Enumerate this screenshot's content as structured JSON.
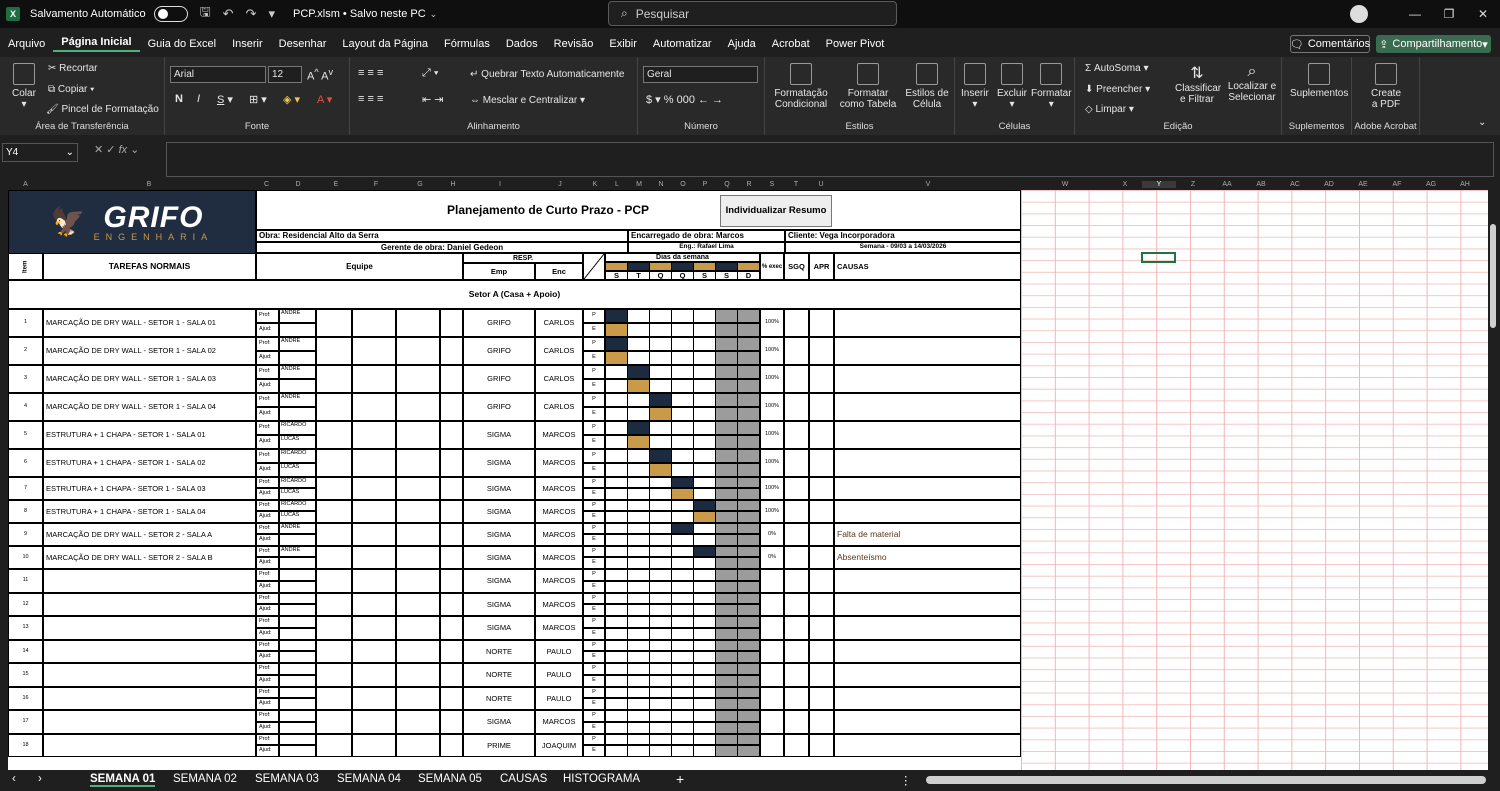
{
  "titlebar": {
    "autosave_label": "Salvamento Automático",
    "file": "PCP.xlsm • Salvo neste PC",
    "search_placeholder": "Pesquisar"
  },
  "menu": [
    "Arquivo",
    "Página Inicial",
    "Guia do Excel",
    "Inserir",
    "Desenhar",
    "Layout da Página",
    "Fórmulas",
    "Dados",
    "Revisão",
    "Exibir",
    "Automatizar",
    "Ajuda",
    "Acrobat",
    "Power Pivot"
  ],
  "menu_active": "Página Inicial",
  "comments_label": "Comentários",
  "share_label": "Compartilhamento",
  "ribbon": {
    "clipboard": {
      "paste": "Colar",
      "cut": "Recortar",
      "copy": "Copiar",
      "painter": "Pincel de Formatação",
      "label": "Área de Transferência"
    },
    "font": {
      "name": "Arial",
      "size": "12",
      "label": "Fonte"
    },
    "align": {
      "wrap": "Quebrar Texto Automaticamente",
      "merge": "Mesclar e Centralizar",
      "label": "Alinhamento"
    },
    "number": {
      "format": "Geral",
      "label": "Número"
    },
    "styles": {
      "cond": "Formatação Condicional",
      "table": "Formatar como Tabela",
      "cell": "Estilos de Célula",
      "label": "Estilos"
    },
    "cells": {
      "insert": "Inserir",
      "delete": "Excluir",
      "format": "Formatar",
      "label": "Células"
    },
    "editing": {
      "autosum": "AutoSoma",
      "fill": "Preencher",
      "clear": "Limpar",
      "sort": "Classificar e Filtrar",
      "find": "Localizar e Selecionar",
      "label": "Edição"
    },
    "addins": {
      "btn": "Suplementos",
      "label": "Suplementos"
    },
    "acrobat": {
      "btn": "Create a PDF",
      "label": "Adobe Acrobat"
    }
  },
  "namebox": "Y4",
  "columns": [
    "A",
    "B",
    "C",
    "D",
    "E",
    "F",
    "G",
    "H",
    "I",
    "J",
    "K",
    "L",
    "M",
    "N",
    "O",
    "P",
    "Q",
    "R",
    "S",
    "T",
    "U",
    "V",
    "W",
    "X",
    "Y",
    "Z",
    "AA",
    "AB",
    "AC",
    "AD",
    "AE",
    "AF",
    "AG",
    "AH"
  ],
  "sheet": {
    "logo_text": "GRIFO",
    "logo_sub": "ENGENHARIA",
    "title": "Planejamento de Curto Prazo - PCP",
    "summary_button": "Individualizar Resumo",
    "obra": "Obra: Residencial Alto da Serra",
    "encarregado": "Encarregado de obra: Marcos",
    "cliente": "Cliente: Vega Incorporadora",
    "gerente": "Gerente de obra: Daniel Gedeon",
    "eng": "Eng.: Rafael Lima",
    "semana": "Semana - 09/03 a 14/03/2026",
    "h_item": "Item",
    "h_tarefas": "TAREFAS NORMAIS",
    "h_equipe": "Equipe",
    "h_resp": "RESP.",
    "h_emp": "Emp",
    "h_enc": "Enc",
    "h_dias": "Dias da semana",
    "days": [
      "S",
      "T",
      "Q",
      "Q",
      "S",
      "S",
      "D"
    ],
    "h_exec": "% exec",
    "h_sgq": "SGQ",
    "h_apr": "APR",
    "h_causas": "CAUSAS",
    "sector": "Setor A (Casa + Apoio)",
    "lbl_p": "P",
    "lbl_e": "E",
    "lbl_prof": "Prof:",
    "lbl_ajud": "Ajud:",
    "rows": [
      {
        "n": "1",
        "task": "MARCAÇÃO DE DRY WALL - SETOR 1 - SALA 01",
        "prof": "ANDRE",
        "ajud": "",
        "emp": "GRIFO",
        "enc": "CARLOS",
        "pct": "100%",
        "cause": ""
      },
      {
        "n": "2",
        "task": "MARCAÇÃO DE DRY WALL - SETOR 1 - SALA 02",
        "prof": "ANDRE",
        "ajud": "",
        "emp": "GRIFO",
        "enc": "CARLOS",
        "pct": "100%",
        "cause": ""
      },
      {
        "n": "3",
        "task": "MARCAÇÃO DE DRY WALL - SETOR 1 - SALA 03",
        "prof": "ANDRE",
        "ajud": "",
        "emp": "GRIFO",
        "enc": "CARLOS",
        "pct": "100%",
        "cause": ""
      },
      {
        "n": "4",
        "task": "MARCAÇÃO DE DRY WALL - SETOR 1 - SALA 04",
        "prof": "ANDRE",
        "ajud": "",
        "emp": "GRIFO",
        "enc": "CARLOS",
        "pct": "100%",
        "cause": ""
      },
      {
        "n": "5",
        "task": "ESTRUTURA + 1 CHAPA - SETOR 1 - SALA 01",
        "prof": "RICARDO",
        "ajud": "LUCAS",
        "emp": "SIGMA",
        "enc": "MARCOS",
        "pct": "100%",
        "cause": ""
      },
      {
        "n": "6",
        "task": "ESTRUTURA + 1 CHAPA - SETOR 1 - SALA 02",
        "prof": "RICARDO",
        "ajud": "LUCAS",
        "emp": "SIGMA",
        "enc": "MARCOS",
        "pct": "100%",
        "cause": ""
      },
      {
        "n": "7",
        "task": "ESTRUTURA + 1 CHAPA - SETOR 1 - SALA 03",
        "prof": "RICARDO",
        "ajud": "LUCAS",
        "emp": "SIGMA",
        "enc": "MARCOS",
        "pct": "100%",
        "cause": ""
      },
      {
        "n": "8",
        "task": "ESTRUTURA + 1 CHAPA - SETOR 1 - SALA 04",
        "prof": "RICARDO",
        "ajud": "LUCAS",
        "emp": "SIGMA",
        "enc": "MARCOS",
        "pct": "100%",
        "cause": ""
      },
      {
        "n": "9",
        "task": "MARCAÇÃO DE DRY WALL - SETOR 2 - SALA A",
        "prof": "ANDRE",
        "ajud": "",
        "emp": "SIGMA",
        "enc": "MARCOS",
        "pct": "0%",
        "cause": "Falta de material"
      },
      {
        "n": "10",
        "task": "MARCAÇÃO DE DRY WALL - SETOR 2 - SALA B",
        "prof": "ANDRE",
        "ajud": "",
        "emp": "SIGMA",
        "enc": "MARCOS",
        "pct": "0%",
        "cause": "Absenteísmo"
      },
      {
        "n": "11",
        "task": "",
        "prof": "",
        "ajud": "",
        "emp": "SIGMA",
        "enc": "MARCOS",
        "pct": "",
        "cause": ""
      },
      {
        "n": "12",
        "task": "",
        "prof": "",
        "ajud": "",
        "emp": "SIGMA",
        "enc": "MARCOS",
        "pct": "",
        "cause": ""
      },
      {
        "n": "13",
        "task": "",
        "prof": "",
        "ajud": "",
        "emp": "SIGMA",
        "enc": "MARCOS",
        "pct": "",
        "cause": ""
      },
      {
        "n": "14",
        "task": "",
        "prof": "",
        "ajud": "",
        "emp": "NORTE",
        "enc": "PAULO",
        "pct": "",
        "cause": ""
      },
      {
        "n": "15",
        "task": "",
        "prof": "",
        "ajud": "",
        "emp": "NORTE",
        "enc": "PAULO",
        "pct": "",
        "cause": ""
      },
      {
        "n": "16",
        "task": "",
        "prof": "",
        "ajud": "",
        "emp": "NORTE",
        "enc": "PAULO",
        "pct": "",
        "cause": ""
      },
      {
        "n": "17",
        "task": "",
        "prof": "",
        "ajud": "",
        "emp": "SIGMA",
        "enc": "MARCOS",
        "pct": "",
        "cause": ""
      },
      {
        "n": "18",
        "task": "",
        "prof": "",
        "ajud": "",
        "emp": "PRIME",
        "enc": "JOAQUIM",
        "pct": "",
        "cause": ""
      }
    ],
    "schedule": [
      {
        "p": [
          0
        ],
        "e": [
          0
        ]
      },
      {
        "p": [
          0
        ],
        "e": [
          0
        ]
      },
      {
        "p": [
          1
        ],
        "e": [
          1
        ]
      },
      {
        "p": [
          2
        ],
        "e": [
          2
        ]
      },
      {
        "p": [
          1
        ],
        "e": [
          1
        ]
      },
      {
        "p": [
          2
        ],
        "e": [
          2
        ]
      },
      {
        "p": [
          3
        ],
        "e": [
          3
        ]
      },
      {
        "p": [
          4
        ],
        "e": [
          4
        ]
      },
      {
        "p": [
          3
        ],
        "e": []
      },
      {
        "p": [
          4
        ],
        "e": []
      }
    ]
  },
  "sheet_tabs": [
    "SEMANA 01",
    "SEMANA 02",
    "SEMANA 03",
    "SEMANA 04",
    "SEMANA 05",
    "CAUSAS",
    "HISTOGRAMA"
  ],
  "active_tab": "SEMANA 01",
  "colors": {
    "navy": "#1c2b3f",
    "gold": "#c99a4a",
    "weekend": "#9c9c9c",
    "accent": "#4fb27a"
  }
}
